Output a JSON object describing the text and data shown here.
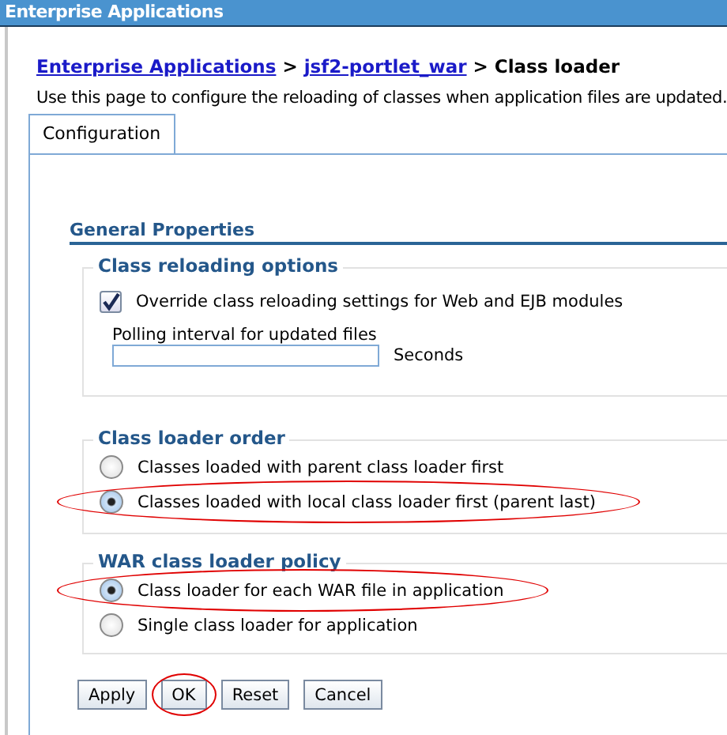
{
  "window": {
    "title": "Enterprise Applications"
  },
  "breadcrumb": [
    {
      "label": "Enterprise Applications",
      "link": true
    },
    {
      "label": "jsf2-portlet_war",
      "link": true
    },
    {
      "label": "Class loader",
      "link": false
    }
  ],
  "separator": ">",
  "description": "Use this page to configure the reloading of classes when application files are updated.",
  "tabs": [
    {
      "label": "Configuration",
      "selected": true
    }
  ],
  "section_title": "General Properties",
  "class_reloading": {
    "legend": "Class reloading options",
    "override": {
      "label": "Override class reloading settings for Web and EJB modules",
      "checked": true
    },
    "polling": {
      "label": "Polling interval for updated files",
      "unit": "Seconds"
    }
  },
  "groups": [
    {
      "legend": "Class loader order",
      "options": [
        {
          "label": "Classes loaded with parent class loader first",
          "selected": false,
          "highlighted": false
        },
        {
          "label": "Classes loaded with local class loader first (parent last)",
          "selected": true,
          "highlighted": true
        }
      ]
    },
    {
      "legend": "WAR class loader policy",
      "options": [
        {
          "label": "Class loader for each WAR file in application",
          "selected": true,
          "highlighted": true
        },
        {
          "label": "Single class loader for application",
          "selected": false,
          "highlighted": false
        }
      ]
    }
  ],
  "buttons": [
    {
      "label": "Apply",
      "highlighted": false
    },
    {
      "label": "OK",
      "highlighted": true
    },
    {
      "label": "Reset",
      "highlighted": false
    },
    {
      "label": "Cancel",
      "highlighted": false
    }
  ]
}
